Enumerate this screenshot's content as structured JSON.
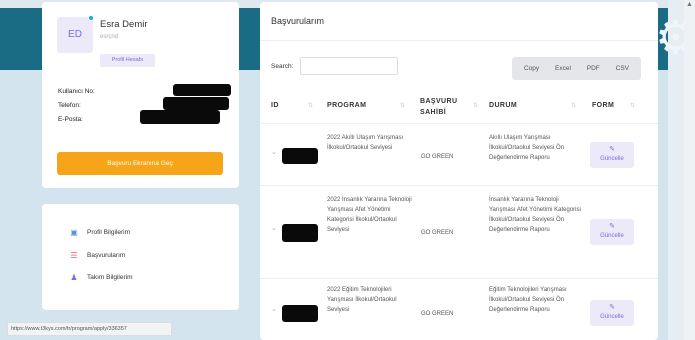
{
  "profile": {
    "initials": "ED",
    "name": "Esra Demir",
    "handle": "esrcnd",
    "profile_link_label": "Profil Hesabı",
    "fields": [
      {
        "label": "Kullanıcı No:"
      },
      {
        "label": "Telefon:"
      },
      {
        "label": "E-Posta:"
      }
    ],
    "apply_button_label": "Başvuru Ekranına Geç"
  },
  "nav": {
    "items": [
      {
        "label": "Profil Bilgilerim",
        "icon": "profile-doc-icon"
      },
      {
        "label": "Başvurularım",
        "icon": "list-icon"
      },
      {
        "label": "Takım Bilgilerim",
        "icon": "team-icon"
      }
    ]
  },
  "main": {
    "title": "Başvurularım",
    "search_label": "Search:",
    "search_value": "",
    "export_buttons": [
      "Copy",
      "Excel",
      "PDF",
      "CSV"
    ],
    "table": {
      "columns": [
        "ID",
        "PROGRAM",
        "BAŞVURU SAHİBİ",
        "DURUM",
        "FORM"
      ],
      "rows": [
        {
          "program": "2022 Akıllı Ulaşım Yarışması İlkokul/Ortaokul Seviyesi",
          "applicant": "GO GREEN",
          "status": "Akıllı Ulaşım Yarışması İlkokul/Ortaokul Seviyesi Ön Değerlendirme Raporu",
          "form_label": "Güncelle"
        },
        {
          "program": "2022 İnsanlık Yararına Teknoloji Yarışması Afet Yönetimi Kategorisi İlkokul/Ortaokul Seviyesi",
          "applicant": "GO GREEN",
          "status": "İnsanlık Yararına Teknoloji Yarışması Afet Yönetimi Kategorisi İlkokul/Ortaokul Seviyesi Ön Değerlendirme Raporu",
          "form_label": "Güncelle"
        },
        {
          "program": "2022 Eğitim Teknolojileri Yarışması İlkokul/Ortaokul Seviyesi",
          "applicant": "GO GREEN",
          "status": "Eğitim Teknolojileri Yarışması İlkokul/Ortaokul Seviyesi Ön Değerlendirme Raporu",
          "form_label": "Güncelle"
        }
      ]
    }
  },
  "status_bar": {
    "url": "https://www.t3kys.com/tr/program/apply/336357"
  },
  "colors": {
    "accent_orange": "#f6a418",
    "purple": "#7c6be0",
    "header_teal": "#1a6c85"
  }
}
